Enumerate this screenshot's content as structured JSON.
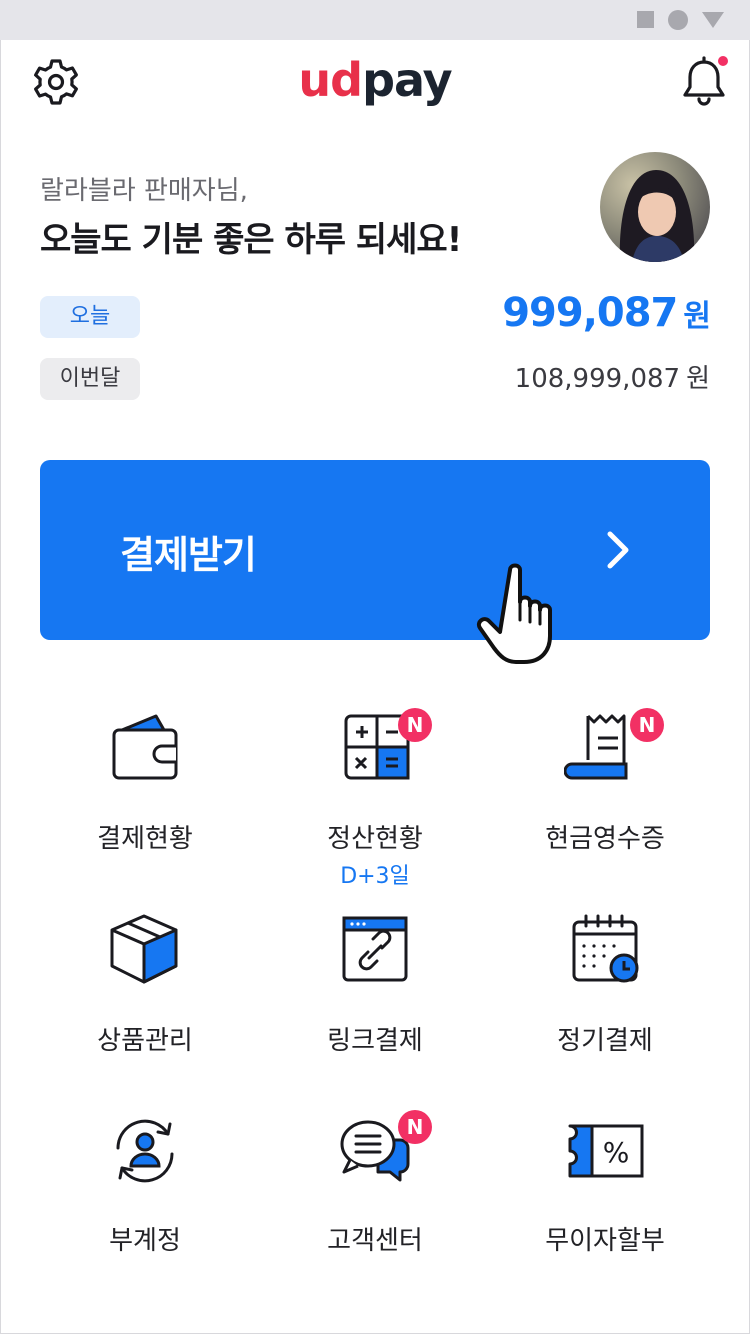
{
  "header": {
    "logo_part1": "ud",
    "logo_part2": "pay",
    "settings_icon": "gear-icon",
    "notification_icon": "bell-icon",
    "notification_dot_color": "#f23064"
  },
  "greeting": {
    "subtitle": "랄라블라 판매자님,",
    "title": "오늘도 기분 좋은 하루 되세요!"
  },
  "summary": {
    "today_label": "오늘",
    "today_amount": "999,087",
    "today_unit": "원",
    "month_label": "이번달",
    "month_amount": "108,999,087",
    "month_unit": "원"
  },
  "pay_button": {
    "label": "결제받기",
    "color": "#1677f2"
  },
  "menu": [
    {
      "label": "결제현황",
      "icon": "wallet-icon"
    },
    {
      "label": "정산현황",
      "icon": "calculator-icon",
      "badge": "N",
      "sub": "D+3일"
    },
    {
      "label": "현금영수증",
      "icon": "receipt-icon",
      "badge": "N"
    },
    {
      "label": "상품관리",
      "icon": "box-icon"
    },
    {
      "label": "링크결제",
      "icon": "link-icon"
    },
    {
      "label": "정기결제",
      "icon": "calendar-clock-icon"
    },
    {
      "label": "부계정",
      "icon": "sub-account-icon"
    },
    {
      "label": "고객센터",
      "icon": "chat-icon",
      "badge": "N"
    },
    {
      "label": "무이자할부",
      "icon": "coupon-percent-icon"
    }
  ],
  "colors": {
    "accent": "#1677f2",
    "badge": "#f23064",
    "brand_red": "#e8304a"
  }
}
